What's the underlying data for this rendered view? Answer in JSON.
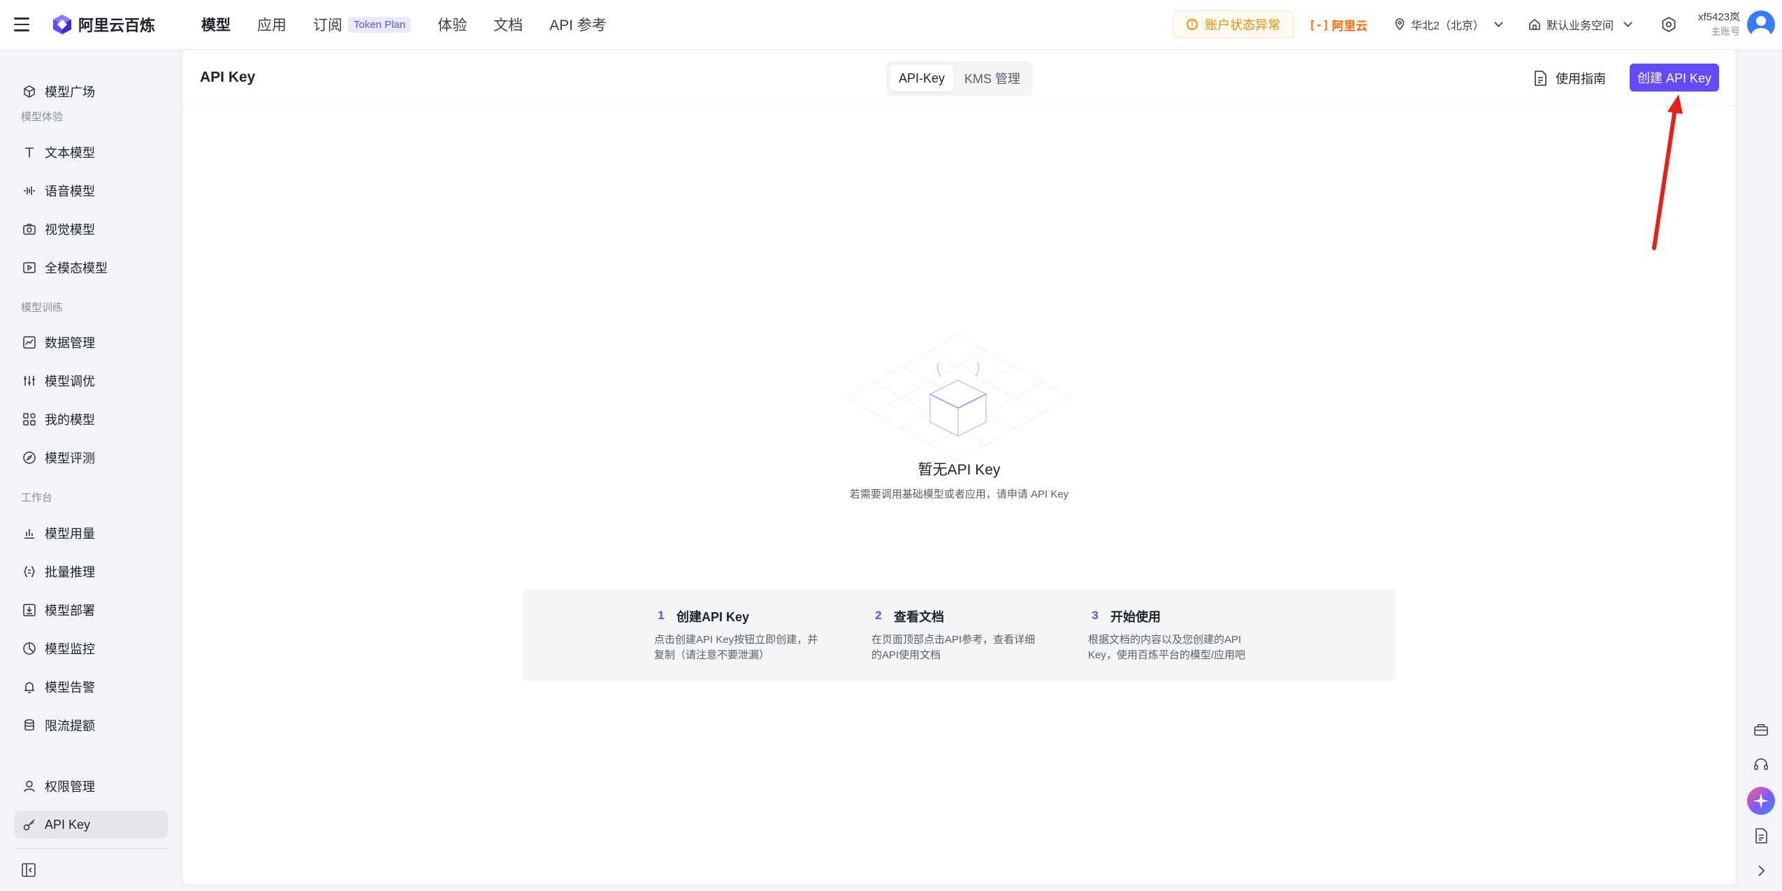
{
  "header": {
    "logo_text": "阿里云百炼",
    "nav": [
      {
        "label": "模型"
      },
      {
        "label": "应用"
      },
      {
        "label": "订阅",
        "badge": "Token Plan"
      },
      {
        "label": "体验"
      },
      {
        "label": "文档"
      },
      {
        "label": "API 参考"
      }
    ],
    "alert": "账户状态异常",
    "aliyun_mark": "[-]",
    "aliyun_label": "阿里云",
    "region": "华北2（北京）",
    "workspace": "默认业务空间",
    "user_name": "xf5423岚",
    "user_role": "主账号"
  },
  "sidebar": {
    "items": [
      {
        "label": "模型广场",
        "icon": "plaza-icon"
      },
      {
        "label": "文本模型",
        "icon": "text-icon"
      },
      {
        "label": "语音模型",
        "icon": "audio-icon"
      },
      {
        "label": "视觉模型",
        "icon": "camera-icon"
      },
      {
        "label": "全模态模型",
        "icon": "omni-icon"
      },
      {
        "label": "数据管理",
        "icon": "chart-icon"
      },
      {
        "label": "模型调优",
        "icon": "sliders-icon"
      },
      {
        "label": "我的模型",
        "icon": "apps-icon"
      },
      {
        "label": "模型评测",
        "icon": "compass-icon"
      },
      {
        "label": "模型用量",
        "icon": "bar-chart-icon"
      },
      {
        "label": "批量推理",
        "icon": "braces-icon"
      },
      {
        "label": "模型部署",
        "icon": "deploy-icon"
      },
      {
        "label": "模型监控",
        "icon": "pie-icon"
      },
      {
        "label": "模型告警",
        "icon": "bell-icon"
      },
      {
        "label": "限流提额",
        "icon": "database-icon"
      },
      {
        "label": "权限管理",
        "icon": "user-icon"
      },
      {
        "label": "API Key",
        "icon": "key-icon"
      }
    ],
    "groups": [
      "模型体验",
      "模型训练",
      "工作台"
    ]
  },
  "main": {
    "title": "API Key",
    "tabs": [
      "API-Key",
      "KMS 管理"
    ],
    "active_tab": "API-Key",
    "guide": "使用指南",
    "create_button": "创建 API Key",
    "empty_title": "暂无API Key",
    "empty_subtitle": "若需要调用基础模型或者应用，请申请 API Key",
    "steps": [
      {
        "num": "1",
        "title": "创建API Key",
        "desc": "点击创建API Key按钮立即创建，并复制（请注意不要泄漏）"
      },
      {
        "num": "2",
        "title": "查看文档",
        "desc": "在页面顶部点击API参考，查看详细的API使用文档"
      },
      {
        "num": "3",
        "title": "开始使用",
        "desc": "根据文档的内容以及您创建的API Key，使用百炼平台的模型/应用吧"
      }
    ]
  },
  "colors": {
    "accent": "#624aff",
    "alert": "#f08c00",
    "aliyun": "#ff6a00",
    "annotation_arrow": "#e8201a"
  }
}
